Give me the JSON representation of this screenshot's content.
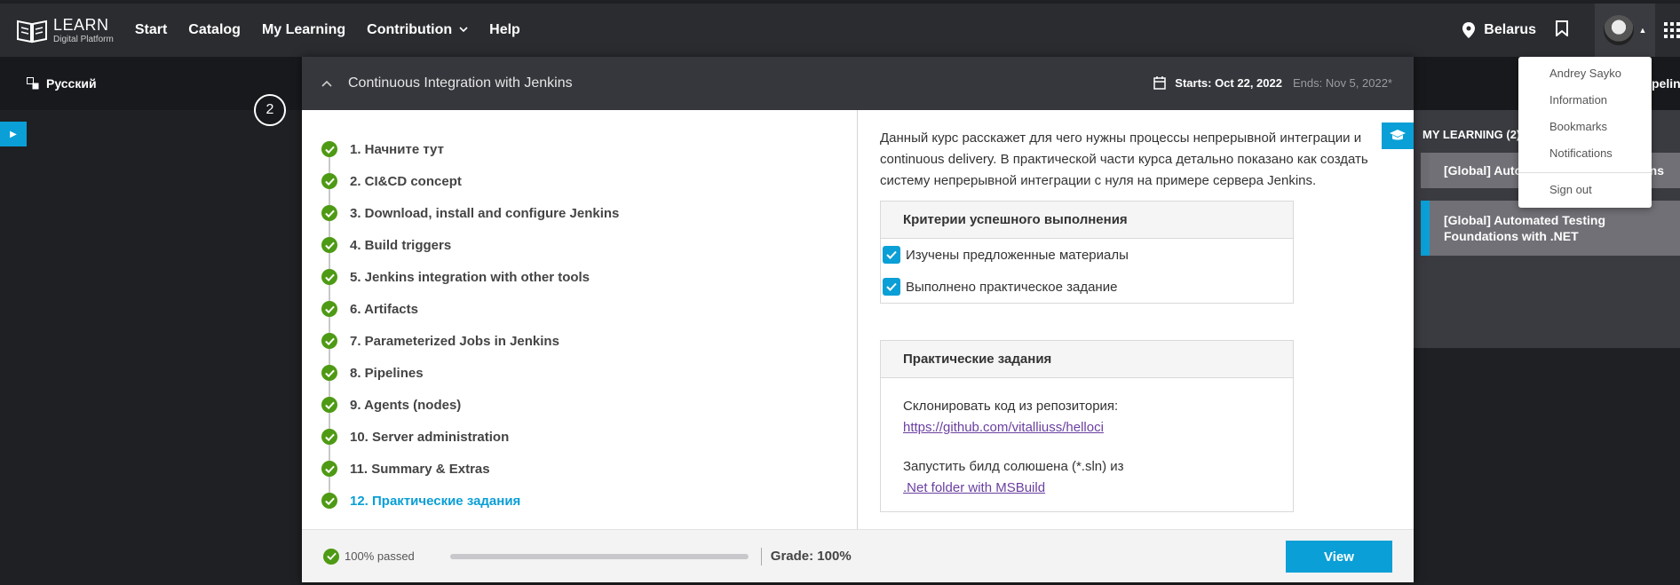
{
  "brand": {
    "title": "LEARN",
    "subtitle": "Digital Platform"
  },
  "nav": {
    "start": "Start",
    "catalog": "Catalog",
    "my_learning": "My Learning",
    "contribution": "Contribution",
    "help": "Help"
  },
  "header_right": {
    "location": "Belarus"
  },
  "language": "Русский",
  "pipeline_fragment": "peline",
  "step_number": "2",
  "course": {
    "title": "Continuous Integration with Jenkins",
    "starts": "Starts: Oct 22, 2022",
    "ends": "Ends: Nov 5, 2022*"
  },
  "toc": [
    {
      "label": "1. Начните тут"
    },
    {
      "label": "2. CI&CD concept"
    },
    {
      "label": "3. Download, install and configure Jenkins"
    },
    {
      "label": "4. Build triggers"
    },
    {
      "label": "5. Jenkins integration with other tools"
    },
    {
      "label": "6. Artifacts"
    },
    {
      "label": "7. Parameterized Jobs in Jenkins"
    },
    {
      "label": "8. Pipelines"
    },
    {
      "label": "9. Agents (nodes)"
    },
    {
      "label": "10. Server administration"
    },
    {
      "label": "11. Summary & Extras"
    },
    {
      "label": "12. Практические задания"
    }
  ],
  "content": {
    "description": "Данный курс расскажет для чего нужны процессы непрерывной интеграции и continuous delivery. В практической части курса детально показано как создать систему непрерывной интеграции с нуля на примере сервера Jenkins.",
    "criteria_title": "Критерии успешного выполнения",
    "criteria": [
      "Изучены предложенные материалы",
      "Выполнено практическое задание"
    ],
    "tasks_title": "Практические задания",
    "task1_text": "Склонировать код из репозитория:",
    "task1_link": "https://github.com/vitalliuss/helloci",
    "task2_text": "Запустить билд солюшена (*.sln) из",
    "task2_link": ".Net folder with MSBuild"
  },
  "footer": {
    "passed": "100% passed",
    "progress": 100,
    "grade": "Grade: 100%",
    "view": "View"
  },
  "my_learning_panel": {
    "title": "MY LEARNING (2)",
    "item1_left": "[Global] Autom",
    "item1_right": "ns",
    "item2": "[Global] Automated Testing Foundations with .NET"
  },
  "user_menu": {
    "name": "Andrey Sayko",
    "information": "Information",
    "bookmarks": "Bookmarks",
    "notifications": "Notifications",
    "sign_out": "Sign out"
  },
  "colors": {
    "accent": "#0a9fd6",
    "success": "#4e9a14",
    "link": "#6a3fa0"
  }
}
